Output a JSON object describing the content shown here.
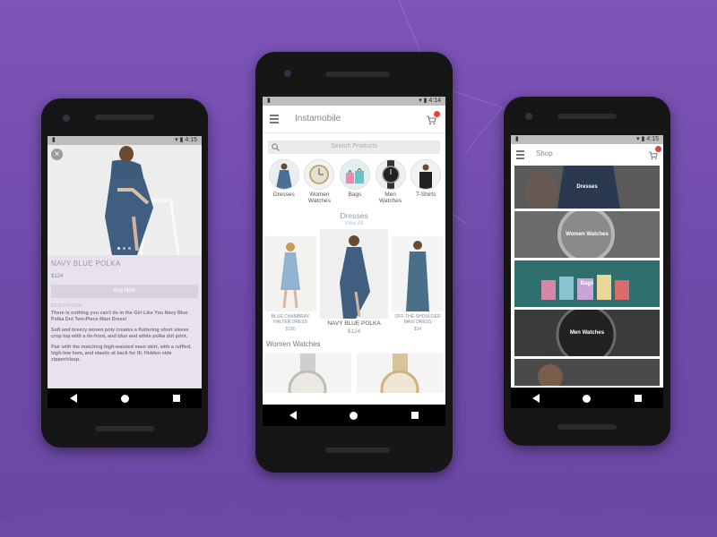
{
  "colors": {
    "background": "#7450ae",
    "accent": "#e24444",
    "status_bar": "#bdbdbd"
  },
  "phone1": {
    "status": {
      "time": "4:15"
    },
    "close_icon": "close-icon",
    "product_title": "NAVY BLUE POLKA",
    "price": "$124",
    "buy_label": "Buy Now",
    "description_header": "DESCRIPTION",
    "description": [
      "There is nothing you can't do in the Girl Like You Navy Blue Polka Dot Two-Piece Maxi Dress!",
      "Soft and breezy woven poly creates a fluttering short sleeve crop top with a tie-front, and blue and white polka dot print.",
      "Pair with the matching high-waisted maxi skirt, with a ruffled, high-low hem, and elastic at back for fit. Hidden side zipper/clasp."
    ]
  },
  "phone2": {
    "status": {
      "time": "4:14"
    },
    "app_title": "Instamobile",
    "search_placeholder": "Search Products",
    "categories": [
      {
        "label": "Dresses",
        "icon": "dress-icon"
      },
      {
        "label": "Women\nWatches",
        "icon": "watch-icon"
      },
      {
        "label": "Bags",
        "icon": "bag-icon"
      },
      {
        "label": "Men\nWatches",
        "icon": "watch-icon"
      },
      {
        "label": "T-Shirts",
        "icon": "tshirt-icon"
      }
    ],
    "featured": {
      "title": "Dresses",
      "view_all": "View All",
      "products": [
        {
          "name": "BLUE CHAMBRAY HALTER DRESS",
          "price": "$180"
        },
        {
          "name": "NAVY BLUE POLKA",
          "price": "$124"
        },
        {
          "name": "OFF-THE-SHOULDER MAXI DRESS",
          "price": "$34"
        }
      ]
    },
    "second_section": "Women Watches"
  },
  "phone3": {
    "status": {
      "time": "4:15"
    },
    "title": "Shop",
    "items": [
      {
        "label": "Dresses"
      },
      {
        "label": "Women Watches"
      },
      {
        "label": "Bags"
      },
      {
        "label": "Men Watches"
      },
      {
        "label": ""
      }
    ]
  }
}
